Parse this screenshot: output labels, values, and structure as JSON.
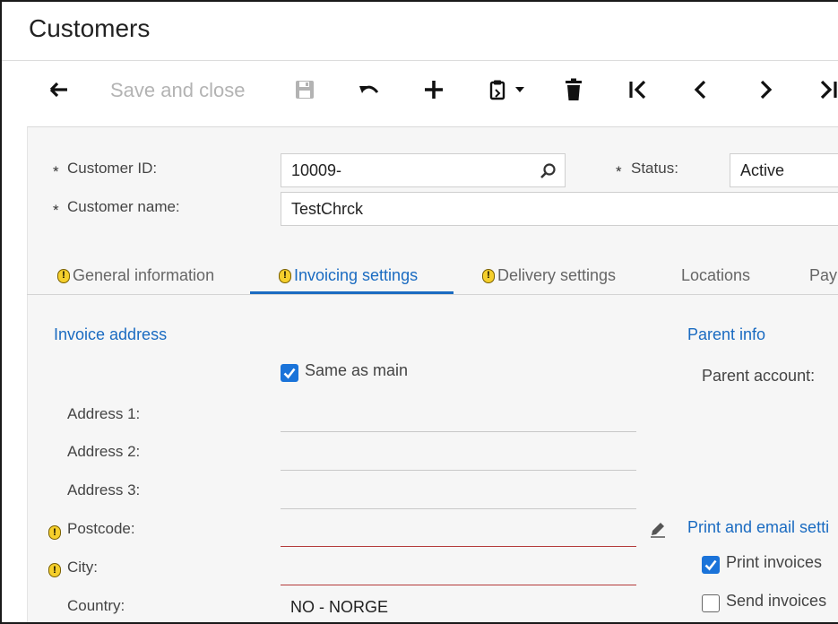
{
  "window": {
    "title": "Customers"
  },
  "toolbar": {
    "save_close_label": "Save and close",
    "icons": [
      "back-icon",
      "save-icon",
      "undo-icon",
      "add-icon",
      "clipboard-icon",
      "delete-icon",
      "first-icon",
      "prev-icon",
      "next-icon",
      "last-icon"
    ]
  },
  "form": {
    "required_marker": "*",
    "customer_id": {
      "label": "Customer ID:",
      "value": "10009-"
    },
    "status": {
      "label": "Status:",
      "value": "Active"
    },
    "customer_name": {
      "label": "Customer name:",
      "value": "TestChrck"
    }
  },
  "tabs": [
    {
      "label": "General information",
      "warning": true
    },
    {
      "label": "Invoicing settings",
      "warning": true,
      "active": true
    },
    {
      "label": "Delivery settings",
      "warning": true
    },
    {
      "label": "Locations",
      "warning": false
    },
    {
      "label": "Pay",
      "warning": false
    }
  ],
  "invoice_address": {
    "title": "Invoice address",
    "same_as_main": {
      "label": "Same as main",
      "checked": true
    },
    "address1": {
      "label": "Address 1:",
      "value": ""
    },
    "address2": {
      "label": "Address 2:",
      "value": ""
    },
    "address3": {
      "label": "Address 3:",
      "value": ""
    },
    "postcode": {
      "label": "Postcode:",
      "value": "",
      "warning": true
    },
    "city": {
      "label": "City:",
      "value": "",
      "warning": true
    },
    "country": {
      "label": "Country:",
      "value": "NO - NORGE"
    }
  },
  "parent_info": {
    "title": "Parent info",
    "parent_account": {
      "label": "Parent account:"
    }
  },
  "print_email": {
    "title": "Print and email setti",
    "print_invoices": {
      "label": "Print invoices",
      "checked": true
    },
    "send_invoices": {
      "label": "Send invoices",
      "checked": false
    }
  },
  "colors": {
    "accent": "#1a6bc1",
    "checkbox": "#1a73d9",
    "warning": "#f5cf2c",
    "error_line": "#b33a3a"
  }
}
